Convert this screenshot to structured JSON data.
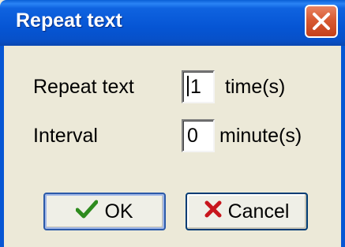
{
  "window": {
    "title": "Repeat text"
  },
  "form": {
    "repeat": {
      "label": "Repeat text",
      "value": "1",
      "unit": "time(s)"
    },
    "interval": {
      "label": "Interval",
      "value": "0",
      "unit": "minute(s)"
    }
  },
  "buttons": {
    "ok_label": "OK",
    "cancel_label": "Cancel"
  },
  "icons": {
    "close": "close-icon",
    "ok": "checkmark-icon",
    "cancel": "x-icon"
  },
  "colors": {
    "titlebar": "#0655d4",
    "dialog_bg": "#ece9d8",
    "close_button": "#d85a32",
    "ok_icon": "#2e8b1e",
    "cancel_icon": "#c8161d"
  }
}
